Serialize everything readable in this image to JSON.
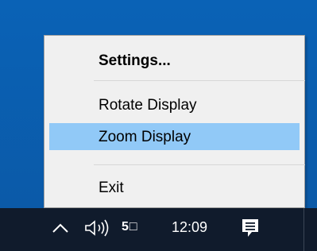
{
  "context_menu": {
    "items": [
      {
        "label": "Settings...",
        "bold": true
      },
      {
        "label": "Rotate Display"
      },
      {
        "label": "Zoom Display",
        "highlighted": true
      },
      {
        "label": "Exit"
      }
    ]
  },
  "taskbar": {
    "ime_indicator": "5□",
    "clock": "12:09",
    "icons": [
      "chevron-up-icon",
      "speaker-icon",
      "notification-icon"
    ]
  },
  "colors": {
    "desktop": "#0b5fae",
    "menu_background": "#f0f0f0",
    "highlight": "#91c9f7",
    "taskbar": "#101b2c"
  }
}
